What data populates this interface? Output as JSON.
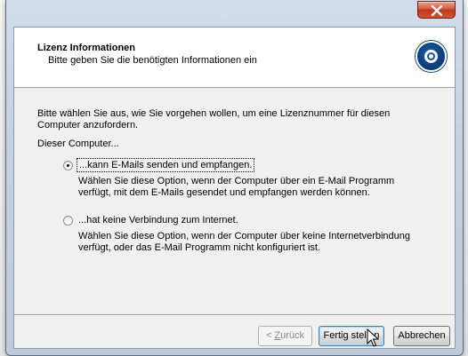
{
  "window": {
    "close_icon": "close-icon"
  },
  "header": {
    "title": "Lizenz Informationen",
    "subtitle": "Bitte geben Sie die benötigten Informationen ein",
    "logo_icon": "disc-logo-icon"
  },
  "body": {
    "intro": "Bitte wählen Sie aus, wie Sie vorgehen wollen, um eine Lizenznummer für diesen Computer anzufordern.",
    "computer_label": "Dieser Computer..."
  },
  "options": [
    {
      "label": "...kann E-Mails senden und empfangen.",
      "description": "Wählen Sie diese Option, wenn der Computer über ein E-Mail Programm verfügt, mit dem E-Mails gesendet und empfangen werden können.",
      "selected": true
    },
    {
      "label": "...hat keine Verbindung zum Internet.",
      "description": "Wählen Sie diese Option, wenn der Computer über keine Internetverbindung verfügt, oder das E-Mail Programm nicht konfiguriert ist.",
      "selected": false
    }
  ],
  "buttons": {
    "back_prefix": "< ",
    "back_underlined": "Z",
    "back_rest": "urück",
    "finish": "Fertig stellen",
    "cancel": "Abbrechen"
  },
  "colors": {
    "close_button": "#c2371a",
    "logo": "#0b3f7c",
    "default_button_border": "#3c7fb1"
  }
}
